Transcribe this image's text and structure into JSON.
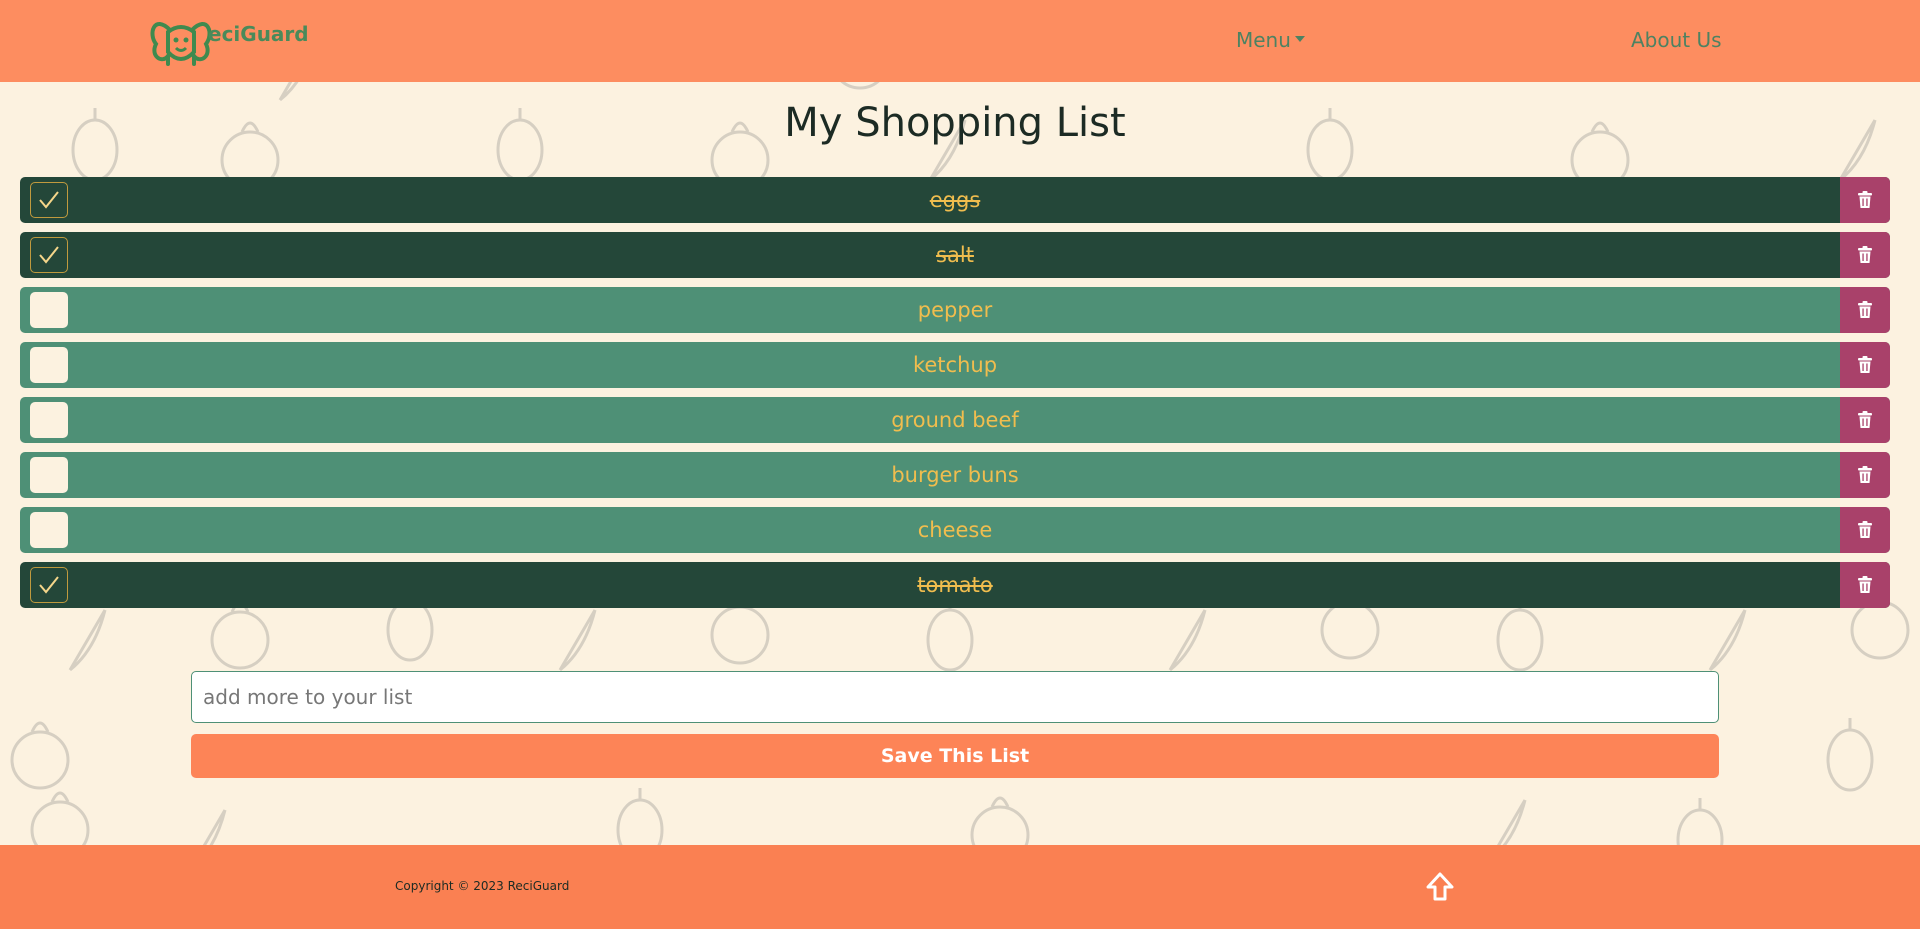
{
  "header": {
    "logo_text": "eciGuard",
    "menu_label": "Menu",
    "about_label": "About Us"
  },
  "page": {
    "title": "My Shopping List"
  },
  "items": [
    {
      "label": "eggs",
      "checked": true
    },
    {
      "label": "salt",
      "checked": true
    },
    {
      "label": "pepper",
      "checked": false
    },
    {
      "label": "ketchup",
      "checked": false
    },
    {
      "label": "ground beef",
      "checked": false
    },
    {
      "label": "burger buns",
      "checked": false
    },
    {
      "label": "cheese",
      "checked": false
    },
    {
      "label": "tomato",
      "checked": true
    }
  ],
  "add_form": {
    "placeholder": "add more to your list",
    "value": "",
    "save_label": "Save This List"
  },
  "footer": {
    "copyright": "Copyright © 2023 ReciGuard"
  },
  "icons": {
    "checkmark": "check-icon",
    "delete": "trash-icon",
    "scroll_top": "arrow-up-icon",
    "menu_caret": "caret-down-icon"
  },
  "colors": {
    "header_bg": "#fd8d60",
    "page_bg": "#fcf2e0",
    "row_checked": "#244739",
    "row_unchecked": "#4e9076",
    "item_text": "#f0bd4e",
    "delete_btn": "#a9416a",
    "save_btn": "#fd8457",
    "footer_bg": "#fa8052"
  }
}
